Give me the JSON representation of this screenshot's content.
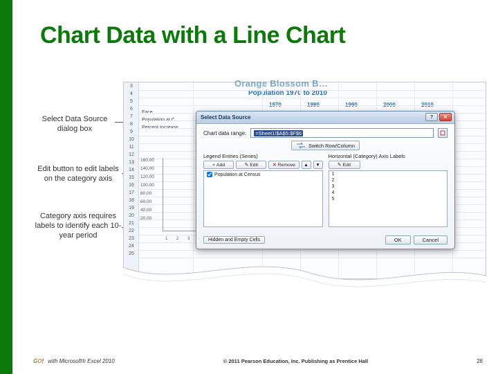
{
  "title": "Chart Data with a Line Chart",
  "callouts": {
    "c1": "Select Data Source dialog box",
    "c2": "Edit button to edit labels on the category axis",
    "c3": "Category axis requires labels to identify each 10-year period"
  },
  "sheet": {
    "title_cut": "Orange Blossom B…",
    "subtitle": "Population 1970 to 2010",
    "years": [
      "1970",
      "1980",
      "1990",
      "2000",
      "2010"
    ],
    "row_labels": [
      "Face",
      "Population at C…",
      "Percent Increase"
    ],
    "row_numbers": [
      "3",
      "4",
      "5",
      "6",
      "7",
      "8",
      "9",
      "10",
      "11",
      "12",
      "13",
      "14",
      "15",
      "16",
      "17",
      "18",
      "19",
      "20",
      "21",
      "22",
      "23",
      "24",
      "25"
    ]
  },
  "dialog": {
    "title": "Select Data Source",
    "range_label": "Chart data range:",
    "range_value": "=Sheet1!$A$5:$F$6",
    "switch_label": "Switch Row/Column",
    "left_header": "Legend Entries (Series)",
    "right_header": "Horizontal (Category) Axis Labels",
    "btn_add": "Add",
    "btn_edit": "Edit",
    "btn_remove": "Remove",
    "btn_edit_r": "Edit",
    "series_item": "Population at Census",
    "axis_items": [
      "1",
      "2",
      "3",
      "4",
      "5"
    ],
    "hidden_btn": "Hidden and Empty Cells",
    "ok": "OK",
    "cancel": "Cancel"
  },
  "minichart": {
    "yticks": [
      "160,00",
      "140,00",
      "120,00",
      "100,00",
      "80,00",
      "60,00",
      "40,00",
      "20,00"
    ],
    "xticks": [
      "1",
      "2",
      "3",
      "4",
      "5"
    ]
  },
  "footer": {
    "product": "with Microsoft® Excel 2010",
    "copyright": "© 2011 Pearson Education, Inc. Publishing as Prentice Hall",
    "page": "28"
  },
  "chart_data": {
    "type": "line",
    "title": "Population 1970 to 2010",
    "categories": [
      "1970",
      "1980",
      "1990",
      "2000",
      "2010"
    ],
    "series": [
      {
        "name": "Population at Census",
        "values": [
          null,
          null,
          null,
          null,
          null
        ]
      }
    ],
    "xlabel": "",
    "ylabel": "",
    "ylim": [
      0,
      160000
    ],
    "note": "Underlying line chart is obscured by the Select Data Source dialog; only axis scaffolding (0–160,000 in 20,000 steps) and category positions 1–5 are visible."
  }
}
